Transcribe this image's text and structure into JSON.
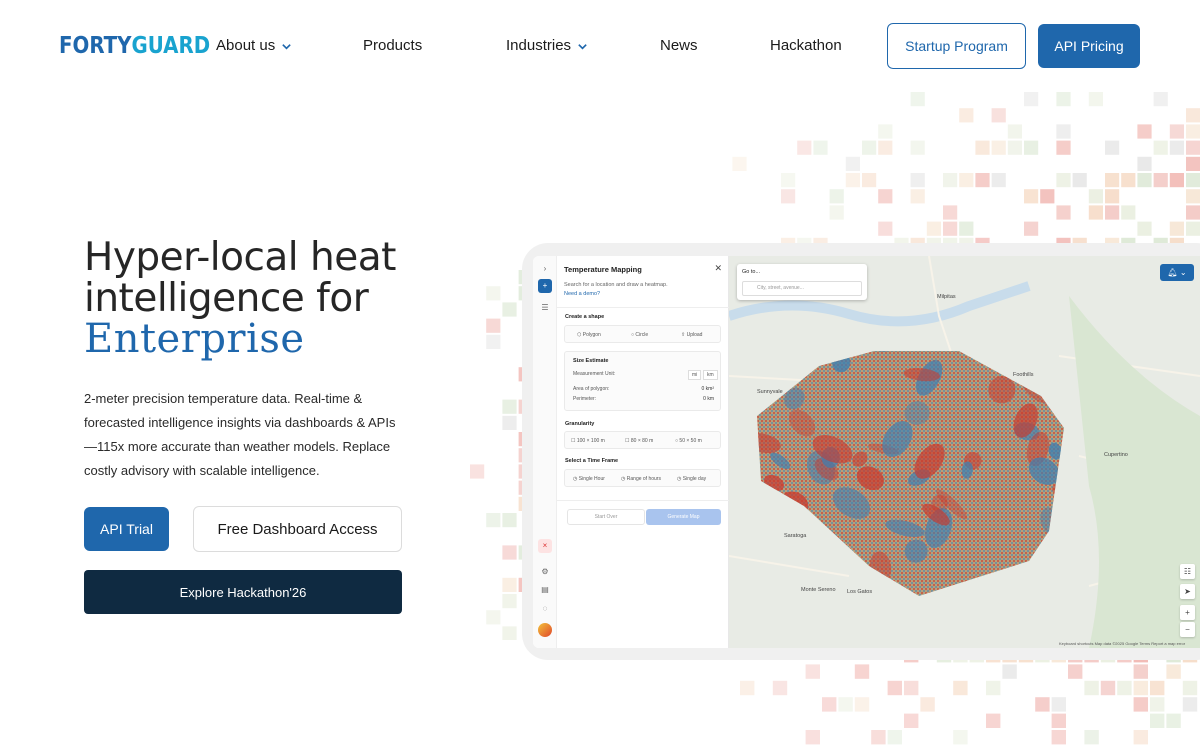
{
  "brand": {
    "logo_part1": "FORTY",
    "logo_part2": "GUARD"
  },
  "nav": {
    "about": "About us",
    "products": "Products",
    "industries": "Industries",
    "news": "News",
    "hackathon": "Hackathon",
    "startup_program": "Startup Program",
    "api_pricing": "API Pricing"
  },
  "hero": {
    "title_line1": "Hyper-local heat",
    "title_line2": "intelligence for",
    "title_accent": "Enterprise",
    "description": "2-meter precision temperature data. Real-time & forecasted intelligence insights via dashboards & APIs —115x more accurate than weather models. Replace costly advisory with scalable intelligence.",
    "btn_api_trial": "API Trial",
    "btn_free_dashboard": "Free Dashboard Access",
    "btn_hackathon": "Explore Hackathon'26"
  },
  "app": {
    "panel_title": "Temperature Mapping",
    "panel_sub": "Search for a location and draw a heatmap.",
    "need_demo": "Need a demo?",
    "create_shape": "Create a shape",
    "shape_polygon": "Polygon",
    "shape_circle": "Circle",
    "shape_upload": "Upload",
    "size_estimate": "Size Estimate",
    "measurement_unit": "Measurement Unit:",
    "unit_mi": "mi",
    "unit_km": "km",
    "area_label": "Area of polygon:",
    "area_value": "0 km²",
    "perimeter_label": "Perimeter:",
    "perimeter_value": "0 km",
    "granularity": "Granularity",
    "gran_100": "100 × 100 m",
    "gran_80": "80 × 80 m",
    "gran_50": "50 × 50 m",
    "time_frame": "Select a Time Frame",
    "tf_single_hour": "Single Hour",
    "tf_range": "Range of hours",
    "tf_single_day": "Single day",
    "start_over": "Start Over",
    "generate_map": "Generate Map",
    "goto_label": "Go to...",
    "goto_placeholder": "City, street, avenue...",
    "map_places": [
      "Milpitas",
      "Sunnyvale",
      "Saratoga",
      "Monte Sereno",
      "Los Gatos",
      "Cupertino",
      "Foothills"
    ],
    "map_footer": "Keyboard shortcuts   Map data ©2025 Google   Terms   Report a map error"
  },
  "colors": {
    "brand_blue": "#1f67ac",
    "brand_cyan": "#19a3cf",
    "dark_navy": "#0f2a41"
  }
}
